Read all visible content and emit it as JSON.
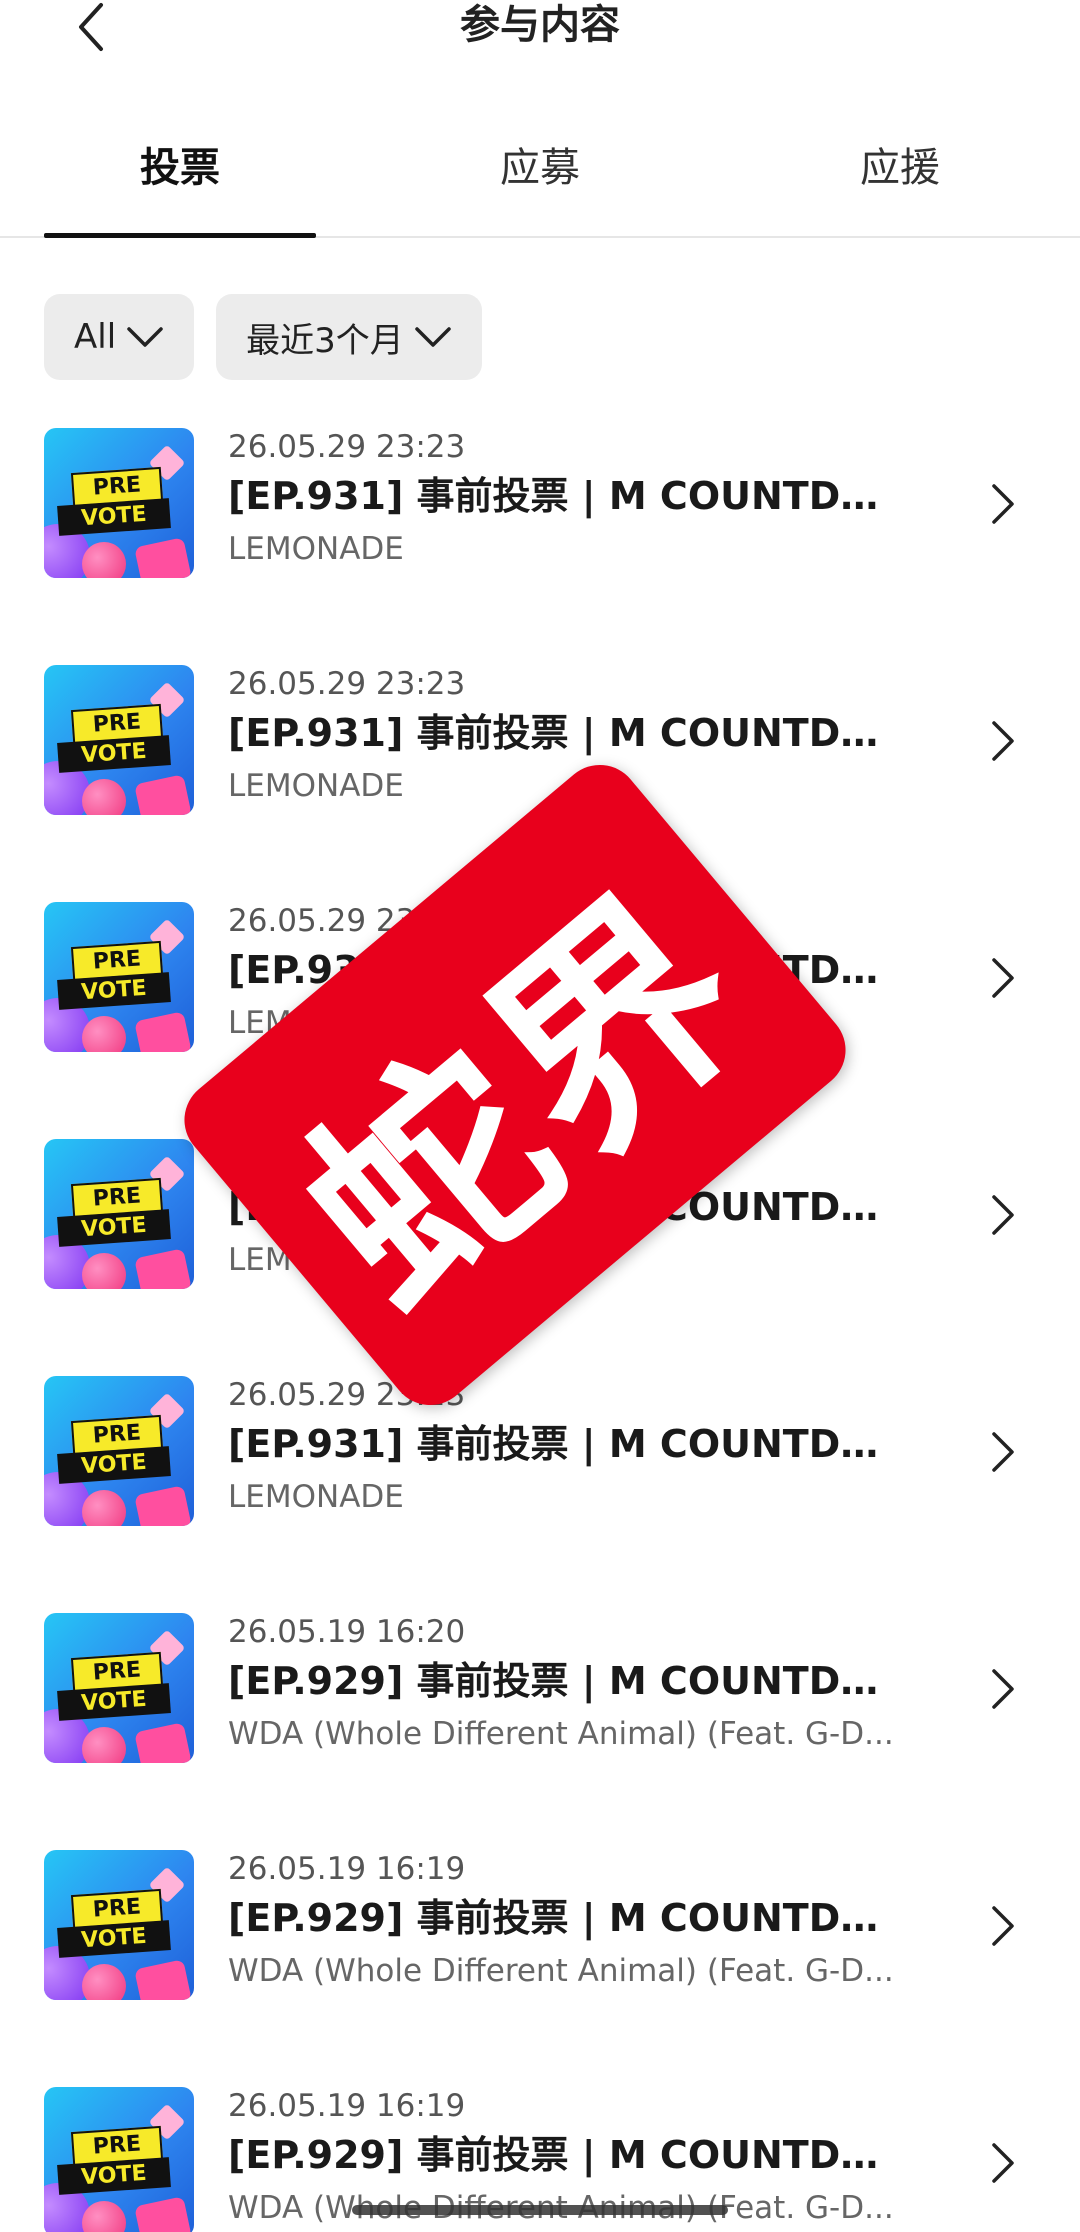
{
  "header": {
    "title": "参与内容",
    "back_icon": "chevron-left-icon"
  },
  "tabs": [
    {
      "label": "投票",
      "active": true
    },
    {
      "label": "应募",
      "active": false
    },
    {
      "label": "应援",
      "active": false
    }
  ],
  "filters": [
    {
      "label": "All",
      "icon": "chevron-down-icon"
    },
    {
      "label": "最近3个月",
      "icon": "chevron-down-icon"
    }
  ],
  "items": [
    {
      "date": "26.05.29 23:23",
      "title": "[EP.931] 事前投票 | M COUNTDO...",
      "subtitle": "LEMONADE",
      "thumb_pre": "PRE",
      "thumb_vote": "VOTE"
    },
    {
      "date": "26.05.29 23:23",
      "title": "[EP.931] 事前投票 | M COUNTDO...",
      "subtitle": "LEMONADE",
      "thumb_pre": "PRE",
      "thumb_vote": "VOTE"
    },
    {
      "date": "26.05.29 23:23",
      "title": "[EP.931] 事前投票 | M COUNTDO...",
      "subtitle": "LEMONADE",
      "thumb_pre": "PRE",
      "thumb_vote": "VOTE"
    },
    {
      "date": "26.05.29 23:23",
      "title": "[EP.931] 事前投票 | M COUNTDO...",
      "subtitle": "LEMONADE",
      "thumb_pre": "PRE",
      "thumb_vote": "VOTE"
    },
    {
      "date": "26.05.29 23:23",
      "title": "[EP.931] 事前投票 | M COUNTDO...",
      "subtitle": "LEMONADE",
      "thumb_pre": "PRE",
      "thumb_vote": "VOTE"
    },
    {
      "date": "26.05.19 16:20",
      "title": "[EP.929] 事前投票 | M COUNTDO...",
      "subtitle": "WDA (Whole Different Animal) (Feat. G-D...",
      "thumb_pre": "PRE",
      "thumb_vote": "VOTE"
    },
    {
      "date": "26.05.19 16:19",
      "title": "[EP.929] 事前投票 | M COUNTDO...",
      "subtitle": "WDA (Whole Different Animal) (Feat. G-D...",
      "thumb_pre": "PRE",
      "thumb_vote": "VOTE"
    },
    {
      "date": "26.05.19 16:19",
      "title": "[EP.929] 事前投票 | M COUNTDO...",
      "subtitle": "WDA (Whole Different Animal) (Feat. G-D...",
      "thumb_pre": "PRE",
      "thumb_vote": "VOTE"
    }
  ],
  "watermark": {
    "text": "蛇界",
    "color": "#e8001c"
  },
  "colors": {
    "chip_bg": "#ececec",
    "tab_indicator": "#111111"
  }
}
